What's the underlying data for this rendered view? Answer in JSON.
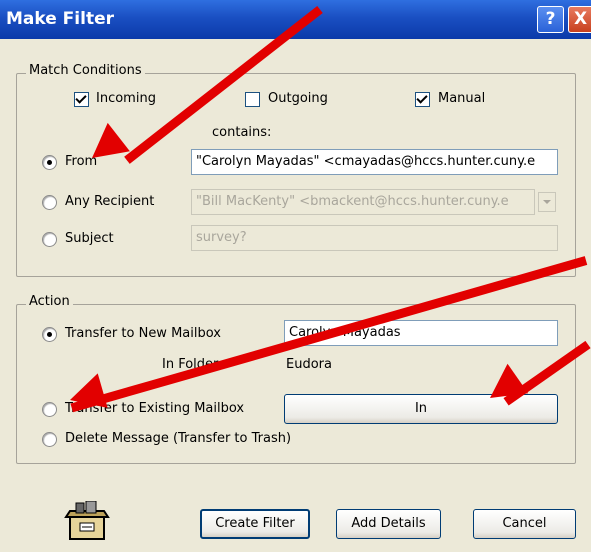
{
  "window": {
    "title": "Make Filter",
    "help_glyph": "?",
    "close_glyph": "X"
  },
  "match": {
    "legend": "Match Conditions",
    "incoming_label": "Incoming",
    "incoming_checked": true,
    "outgoing_label": "Outgoing",
    "outgoing_checked": false,
    "manual_label": "Manual",
    "manual_checked": true,
    "contains_label": "contains:",
    "options": [
      {
        "label": "From",
        "selected": true,
        "value": "\"Carolyn Mayadas\" <cmayadas@hccs.hunter.cuny.e"
      },
      {
        "label": "Any Recipient",
        "selected": false,
        "value": "\"Bill MacKenty\" <bmackent@hccs.hunter.cuny.e"
      },
      {
        "label": "Subject",
        "selected": false,
        "value": "survey?"
      }
    ]
  },
  "action": {
    "legend": "Action",
    "new_mailbox_label": "Transfer to New Mailbox",
    "new_mailbox_value": "Carolyn Mayadas",
    "in_folder_label": "In Folder:",
    "in_folder_value": "Eudora",
    "existing_mailbox_label": "Transfer to Existing Mailbox",
    "existing_mailbox_button": "In",
    "delete_label": "Delete Message (Transfer to Trash)"
  },
  "footer": {
    "create_button": "Create Filter",
    "details_button": "Add Details",
    "cancel_button": "Cancel"
  },
  "colors": {
    "annotation_arrow": "#e20000",
    "titlebar": "#0b3aa9",
    "dialog_bg": "#ece9d8"
  }
}
